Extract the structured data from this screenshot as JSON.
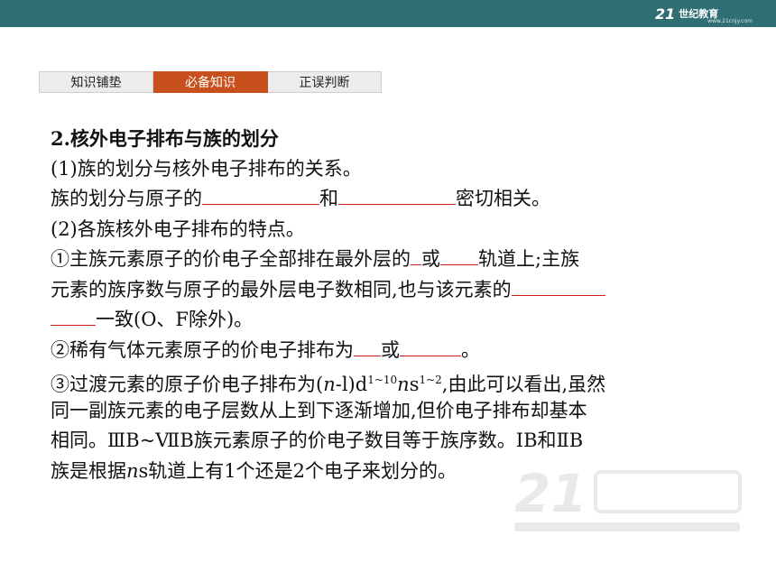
{
  "header": {
    "logo_mark": "21",
    "logo_text": "世纪教育",
    "logo_sub": "www.21cnjy.com"
  },
  "tabs": [
    {
      "label": "知识铺垫",
      "active": false
    },
    {
      "label": "必备知识",
      "active": true
    },
    {
      "label": "正误判断",
      "active": false
    }
  ],
  "content": {
    "heading": "2.核外电子排布与族的划分",
    "l1": "(1)族的划分与核外电子排布的关系。",
    "l2a": "族的划分与原子的",
    "l2b": "和",
    "l2c": "密切相关。",
    "l3": "(2)各族核外电子排布的特点。",
    "l4a": "①主族元素原子的价电子全部排在最外层的",
    "l4b": "或",
    "l4c": "轨道上;主族",
    "l5a": "元素的族序数与原子的最外层电子数相同,也与该元素的",
    "l6a": "一致(O、F除外)。",
    "l7a": "②稀有气体元素原子的价电子排布为",
    "l7b": "或",
    "l7c": "。",
    "l8a": "③过渡元素的原子价电子排布为(",
    "l8n": "n",
    "l8b": "-l)d",
    "l8sup1": "1~10",
    "l8n2": "n",
    "l8c": "s",
    "l8sup2": "1~2",
    "l8d": ",由此可以看出,虽然",
    "l9": "同一副族元素的电子层数从上到下逐渐增加,但价电子排布却基本",
    "l10": "相同。ⅢB~ⅦB族元素原子的价电子数目等于族序数。ⅠB和ⅡB",
    "l11a": "族是根据",
    "l11n": "n",
    "l11b": "s轨道上有1个还是2个电子来划分的。"
  },
  "colors": {
    "header_bg": "#2f6f73",
    "active_tab": "#c8501c",
    "blank_underline": "#d21c1c"
  }
}
